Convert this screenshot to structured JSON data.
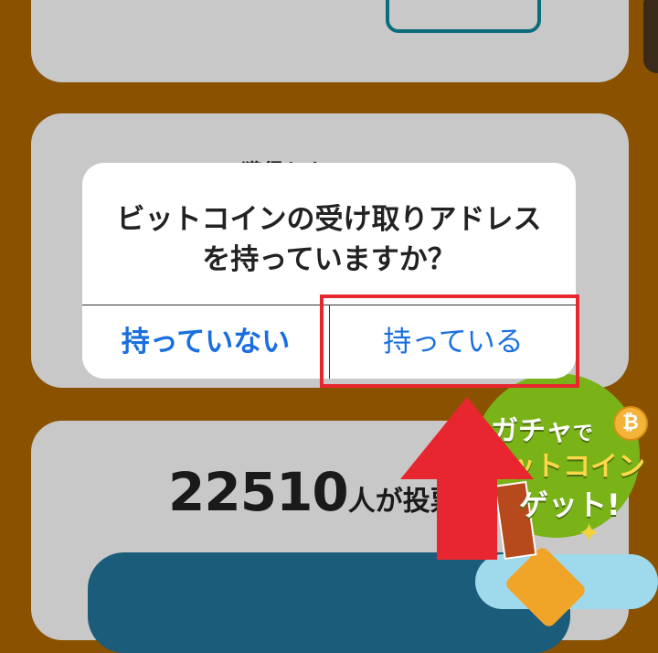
{
  "background": {
    "vote_count": "22510",
    "vote_suffix": "人が投票",
    "hidden_heading": "獲得した"
  },
  "banner": {
    "line1": "ガチャ",
    "line1_suffix": "で",
    "line2": "ットコイン",
    "line3": "ゲット!",
    "coin_symbol": "₿",
    "sparkle": "✦"
  },
  "dialog": {
    "message_line1": "ビットコインの受け取りアドレス",
    "message_line2": "を持っていますか？",
    "negative_label": "持っていない",
    "positive_label": "持っている"
  },
  "colors": {
    "page_bg": "#8a5200",
    "card_bg": "#c8c8c8",
    "button_text": "#1a6fe0",
    "annotation_red": "#e8262f",
    "banner_green": "#7ab317"
  }
}
